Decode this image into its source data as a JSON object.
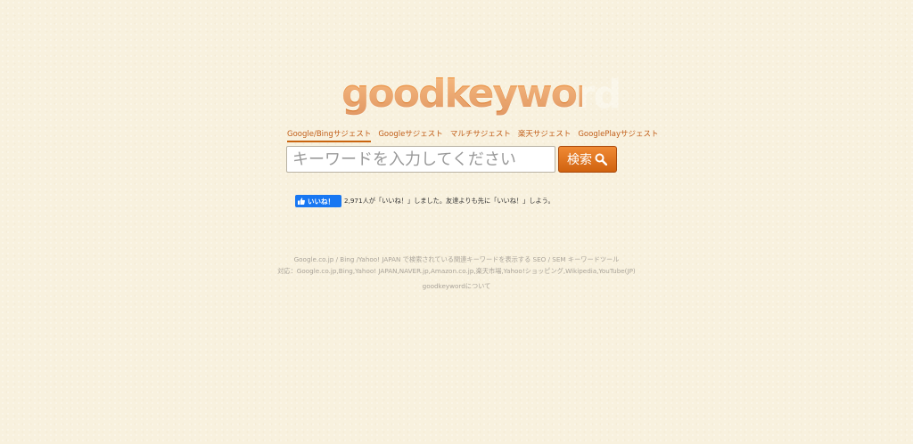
{
  "logo": {
    "text": "goodkeyword"
  },
  "tabs": [
    {
      "label": "Google/Bingサジェスト",
      "active": true
    },
    {
      "label": "Googleサジェスト"
    },
    {
      "label": "マルチサジェスト"
    },
    {
      "label": "楽天サジェスト"
    },
    {
      "label": "GooglePlayサジェスト"
    }
  ],
  "search": {
    "placeholder": "キーワードを入力してください",
    "value": "",
    "button_label": "検索",
    "button_icon": "magnifier-icon"
  },
  "facebook": {
    "like_label": "いいね！",
    "like_icon": "thumbs-up-icon",
    "social_text": "2,971人が「いいね！」しました。友達よりも先に「いいね！」しよう。"
  },
  "footer": {
    "line1": "Google.co.jp / Bing /Yahoo! JAPAN で検索されている関連キーワードを表示する SEO / SEM キーワードツール",
    "line2": "対応：Google.co.jp,Bing,Yahoo! JAPAN,NAVER.jp,Amazon.co.jp,楽天市場,Yahoo!ショッピング,Wikipedia,YouTube(JP)",
    "about_link": "goodkeywordについて"
  },
  "colors": {
    "background": "#f8f1de",
    "accent": "#d86a17",
    "facebook_blue": "#1877f2",
    "footer_text": "#aaa49a"
  }
}
